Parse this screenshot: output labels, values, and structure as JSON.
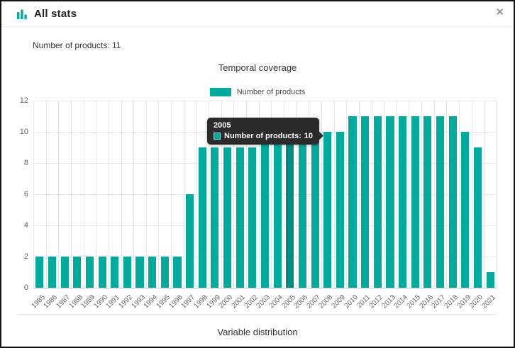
{
  "dialog": {
    "title": "All stats",
    "close_glyph": "✕"
  },
  "summary": {
    "text": "Number of products: 11"
  },
  "chart": {
    "legend_label": "Number of products"
  },
  "tooltip": {
    "year": "2005",
    "label": "Number of products:",
    "value": "10"
  },
  "footer": {
    "next_section_title": "Variable distribution"
  },
  "colors": {
    "accent": "#00ab9e",
    "bar": "#00ab9e",
    "bar_highlight": "#008c82",
    "grid": "#e7e7e7",
    "axis_line": "#cccccc",
    "tooltip_bg": "#2b2b2b",
    "text_secondary": "#666666"
  },
  "chart_data": {
    "type": "bar",
    "title": "Temporal coverage",
    "legend": [
      "Number of products"
    ],
    "legend_position": "top",
    "grid": true,
    "xlabel": "",
    "ylabel": "",
    "ylim": [
      0,
      12
    ],
    "ytick_step": 2,
    "highlighted_category": "2005",
    "categories": [
      "1985",
      "1986",
      "1987",
      "1988",
      "1989",
      "1990",
      "1991",
      "1992",
      "1993",
      "1994",
      "1995",
      "1996",
      "1997",
      "1998",
      "1999",
      "2000",
      "2001",
      "2002",
      "2003",
      "2004",
      "2005",
      "2006",
      "2007",
      "2008",
      "2009",
      "2010",
      "2011",
      "2012",
      "2013",
      "2014",
      "2015",
      "2016",
      "2017",
      "2018",
      "2019",
      "2020",
      "2021"
    ],
    "series": [
      {
        "name": "Number of products",
        "values": [
          2,
          2,
          2,
          2,
          2,
          2,
          2,
          2,
          2,
          2,
          2,
          2,
          6,
          9,
          9,
          9,
          9,
          9,
          10,
          10,
          10,
          10,
          10,
          10,
          10,
          11,
          11,
          11,
          11,
          11,
          11,
          11,
          11,
          11,
          10,
          9,
          1
        ]
      }
    ]
  }
}
